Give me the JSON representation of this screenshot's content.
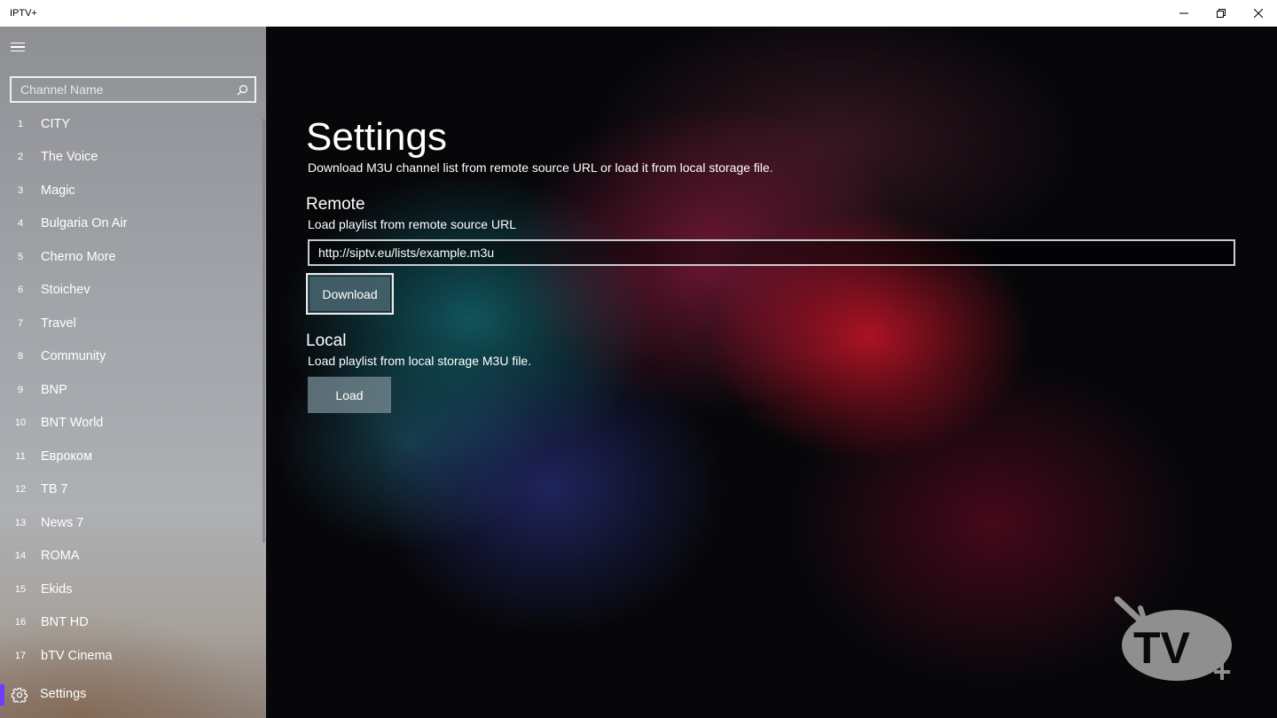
{
  "window": {
    "title": "IPTV+",
    "controls": [
      "minimize-icon",
      "restore-icon",
      "close-icon"
    ]
  },
  "sidebar": {
    "menu_icon": "hamburger-icon",
    "search": {
      "placeholder": "Channel Name",
      "value": "",
      "icon": "search-icon"
    },
    "channels": [
      {
        "number": "1",
        "name": "CITY"
      },
      {
        "number": "2",
        "name": "The Voice"
      },
      {
        "number": "3",
        "name": "Magic"
      },
      {
        "number": "4",
        "name": "Bulgaria On Air"
      },
      {
        "number": "5",
        "name": "Cherno More"
      },
      {
        "number": "6",
        "name": "Stoichev"
      },
      {
        "number": "7",
        "name": "Travel"
      },
      {
        "number": "8",
        "name": "Community"
      },
      {
        "number": "9",
        "name": "BNP"
      },
      {
        "number": "10",
        "name": "BNT World"
      },
      {
        "number": "11",
        "name": "Евроком"
      },
      {
        "number": "12",
        "name": "ТВ 7"
      },
      {
        "number": "13",
        "name": "News 7"
      },
      {
        "number": "14",
        "name": "ROMA"
      },
      {
        "number": "15",
        "name": "Ekids"
      },
      {
        "number": "16",
        "name": "BNT HD"
      },
      {
        "number": "17",
        "name": "bTV Cinema"
      }
    ],
    "settings": {
      "label": "Settings",
      "icon": "gear-icon",
      "selected": true
    }
  },
  "main": {
    "title": "Settings",
    "subtitle": "Download M3U channel list from remote source URL or load it from local storage file.",
    "remote": {
      "heading": "Remote",
      "description": "Load playlist from remote source URL",
      "url_value": "http://siptv.eu/lists/example.m3u",
      "download_label": "Download"
    },
    "local": {
      "heading": "Local",
      "description": "Load playlist from local storage M3U file.",
      "load_label": "Load"
    },
    "logo": {
      "text": "TV",
      "plus": "+",
      "icon": "tv-antenna-icon"
    }
  },
  "colors": {
    "accent": "#6d3cff",
    "titlebar": "#ffffff",
    "text": "#ffffff"
  }
}
